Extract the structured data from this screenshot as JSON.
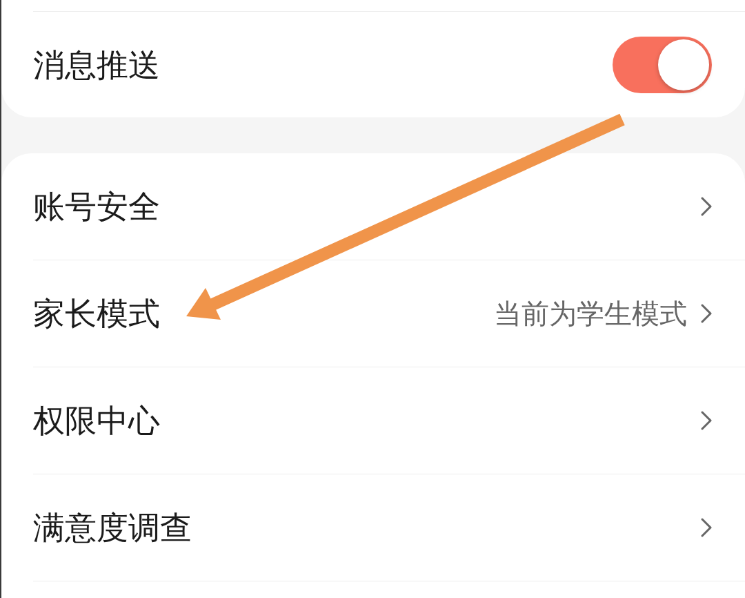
{
  "settings_groups": [
    {
      "rows": [
        {
          "kind": "toggle",
          "label": "消息推送",
          "on": true
        }
      ]
    },
    {
      "rows": [
        {
          "kind": "link",
          "label": "账号安全"
        },
        {
          "kind": "link",
          "label": "家长模式",
          "value": "当前为学生模式"
        },
        {
          "kind": "link",
          "label": "权限中心"
        },
        {
          "kind": "link",
          "label": "满意度调查"
        }
      ]
    }
  ]
}
